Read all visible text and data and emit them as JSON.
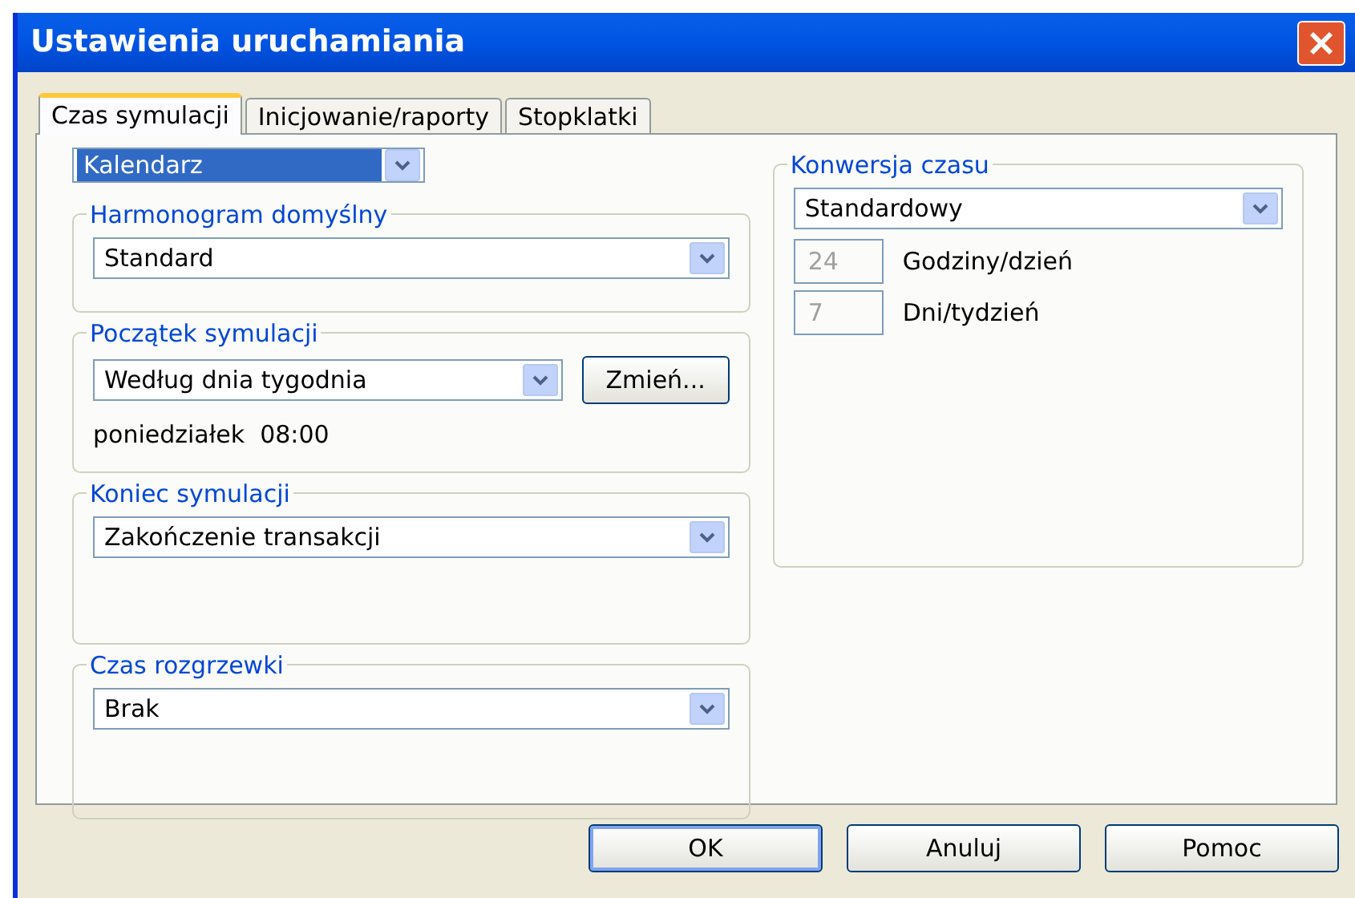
{
  "window": {
    "title": "Ustawienia uruchamiania"
  },
  "tabs": [
    {
      "label": "Czas symulacji",
      "selected": true
    },
    {
      "label": "Inicjowanie/raporty",
      "selected": false
    },
    {
      "label": "Stopklatki",
      "selected": false
    }
  ],
  "calendar_select": {
    "value": "Kalendarz",
    "highlighted": true
  },
  "groups": [
    {
      "title": "Harmonogram domyślny",
      "select": "Standard"
    },
    {
      "title": "Początek symulacji",
      "select": "Według dnia tygodnia",
      "button": "Zmień...",
      "note": "poniedziałek  08:00"
    },
    {
      "title": "Koniec symulacji",
      "select": "Zakończenie transakcji"
    },
    {
      "title": "Czas rozgrzewki",
      "select": "Brak"
    }
  ],
  "time_conversion": {
    "title": "Konwersja czasu",
    "select": "Standardowy",
    "fields": [
      {
        "value": "24",
        "label": "Godziny/dzień",
        "disabled": true
      },
      {
        "value": "7",
        "label": "Dni/tydzień",
        "disabled": true
      }
    ]
  },
  "buttons": [
    {
      "label": "OK",
      "default": true
    },
    {
      "label": "Anuluj",
      "default": false
    },
    {
      "label": "Pomoc",
      "default": false
    }
  ]
}
